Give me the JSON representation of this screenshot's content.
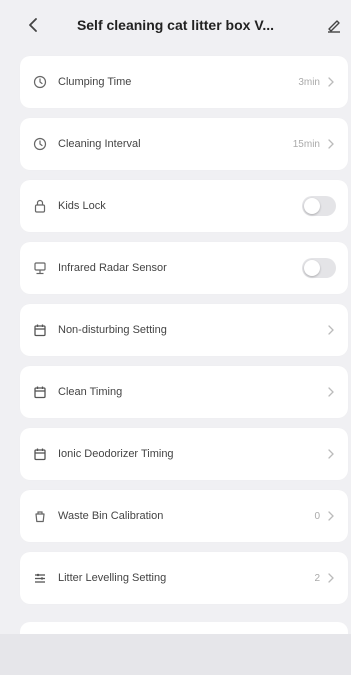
{
  "header": {
    "title": "Self cleaning cat litter box V..."
  },
  "settings": [
    {
      "label": "Clumping Time",
      "value": "3min",
      "icon": "clock-icon",
      "control": "chevron"
    },
    {
      "label": "Cleaning Interval",
      "value": "15min",
      "icon": "clock-icon",
      "control": "chevron"
    },
    {
      "label": "Kids Lock",
      "value": "",
      "icon": "lock-icon",
      "control": "toggle",
      "on": false
    },
    {
      "label": "Infrared Radar Sensor",
      "value": "",
      "icon": "sensor-icon",
      "control": "toggle",
      "on": false
    },
    {
      "label": "Non-disturbing Setting",
      "value": "",
      "icon": "calendar-icon",
      "control": "chevron"
    },
    {
      "label": "Clean Timing",
      "value": "",
      "icon": "calendar-icon",
      "control": "chevron"
    },
    {
      "label": "Ionic Deodorizer Timing",
      "value": "",
      "icon": "calendar-icon",
      "control": "chevron"
    },
    {
      "label": "Waste Bin Calibration",
      "value": "0",
      "icon": "bin-icon",
      "control": "chevron"
    },
    {
      "label": "Litter Levelling Setting",
      "value": "2",
      "icon": "levelling-icon",
      "control": "chevron"
    }
  ],
  "colors": {
    "background": "#f0f0f3",
    "card": "#ffffff",
    "toggle_off": "#e4e4e7"
  }
}
